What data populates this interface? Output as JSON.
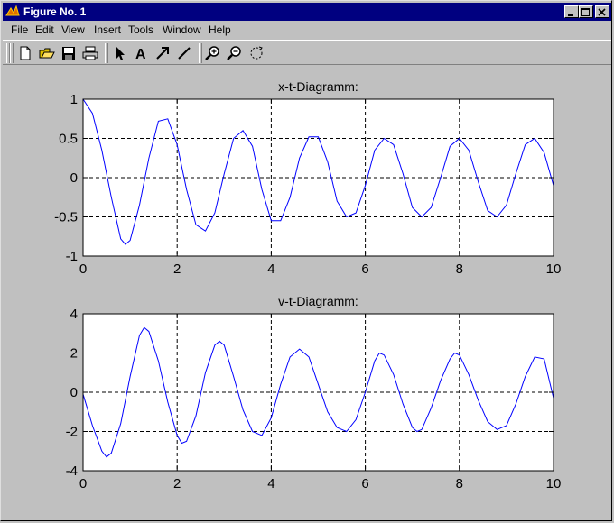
{
  "window": {
    "title": "Figure No. 1"
  },
  "menu": [
    "File",
    "Edit",
    "View",
    "Insert",
    "Tools",
    "Window",
    "Help"
  ],
  "toolbar": {
    "tools": [
      "new-file",
      "open-file",
      "save",
      "print",
      "select-arrow",
      "insert-text",
      "insert-arrow",
      "insert-line",
      "zoom-in",
      "zoom-out",
      "rotate-3d"
    ]
  },
  "colors": {
    "background": "#c0c0c0",
    "titlebar": "#000080",
    "line": "#0000ff"
  },
  "chart_data": [
    {
      "type": "line",
      "title": "x-t-Diagramm:",
      "xlabel": "",
      "ylabel": "",
      "xlim": [
        0,
        10
      ],
      "ylim": [
        -1,
        1
      ],
      "xticks": [
        "0",
        "2",
        "4",
        "6",
        "8",
        "10"
      ],
      "yticks": [
        "1",
        "0.5",
        "0",
        "-0.5",
        "-1"
      ],
      "grid": true,
      "series": [
        {
          "x": [
            0,
            0.2,
            0.4,
            0.6,
            0.8,
            0.9,
            1.0,
            1.2,
            1.4,
            1.6,
            1.8,
            2.0,
            2.2,
            2.4,
            2.6,
            2.8,
            3.0,
            3.2,
            3.4,
            3.6,
            3.8,
            4.0,
            4.2,
            4.4,
            4.6,
            4.8,
            5.0,
            5.2,
            5.4,
            5.6,
            5.8,
            6.0,
            6.2,
            6.4,
            6.6,
            6.8,
            7.0,
            7.2,
            7.4,
            7.6,
            7.8,
            8.0,
            8.2,
            8.4,
            8.6,
            8.8,
            9.0,
            9.2,
            9.4,
            9.6,
            9.8,
            10.0
          ],
          "values": [
            1.0,
            0.82,
            0.35,
            -0.25,
            -0.78,
            -0.85,
            -0.8,
            -0.35,
            0.25,
            0.72,
            0.75,
            0.42,
            -0.15,
            -0.6,
            -0.68,
            -0.45,
            0.05,
            0.5,
            0.6,
            0.4,
            -0.15,
            -0.55,
            -0.55,
            -0.25,
            0.25,
            0.52,
            0.52,
            0.2,
            -0.3,
            -0.5,
            -0.45,
            -0.1,
            0.35,
            0.5,
            0.42,
            0.05,
            -0.38,
            -0.5,
            -0.38,
            0.0,
            0.4,
            0.5,
            0.35,
            -0.05,
            -0.42,
            -0.5,
            -0.35,
            0.05,
            0.42,
            0.5,
            0.32,
            -0.1
          ]
        }
      ]
    },
    {
      "type": "line",
      "title": "v-t-Diagramm:",
      "xlabel": "",
      "ylabel": "",
      "xlim": [
        0,
        10
      ],
      "ylim": [
        -4,
        4
      ],
      "xticks": [
        "0",
        "2",
        "4",
        "6",
        "8",
        "10"
      ],
      "yticks": [
        "4",
        "2",
        "0",
        "-2",
        "-4"
      ],
      "grid": true,
      "series": [
        {
          "x": [
            0,
            0.2,
            0.4,
            0.5,
            0.6,
            0.8,
            1.0,
            1.2,
            1.3,
            1.4,
            1.6,
            1.8,
            2.0,
            2.1,
            2.2,
            2.4,
            2.6,
            2.8,
            2.9,
            3.0,
            3.2,
            3.4,
            3.6,
            3.8,
            4.0,
            4.2,
            4.4,
            4.6,
            4.8,
            5.0,
            5.2,
            5.4,
            5.6,
            5.8,
            6.0,
            6.2,
            6.3,
            6.4,
            6.6,
            6.8,
            7.0,
            7.1,
            7.2,
            7.4,
            7.6,
            7.8,
            7.9,
            8.0,
            8.2,
            8.4,
            8.6,
            8.8,
            9.0,
            9.2,
            9.4,
            9.6,
            9.8,
            10.0
          ],
          "values": [
            -0.1,
            -1.7,
            -3.0,
            -3.3,
            -3.1,
            -1.6,
            0.8,
            2.9,
            3.3,
            3.1,
            1.6,
            -0.5,
            -2.2,
            -2.6,
            -2.5,
            -1.2,
            1.0,
            2.4,
            2.6,
            2.4,
            0.8,
            -0.9,
            -2.0,
            -2.2,
            -1.3,
            0.4,
            1.8,
            2.2,
            1.8,
            0.4,
            -1.0,
            -1.8,
            -2.0,
            -1.4,
            0.0,
            1.6,
            2.0,
            1.9,
            0.9,
            -0.6,
            -1.8,
            -2.0,
            -1.9,
            -0.8,
            0.6,
            1.7,
            2.0,
            1.9,
            0.9,
            -0.4,
            -1.5,
            -1.9,
            -1.7,
            -0.6,
            0.8,
            1.8,
            1.7,
            -0.3
          ]
        }
      ]
    }
  ]
}
